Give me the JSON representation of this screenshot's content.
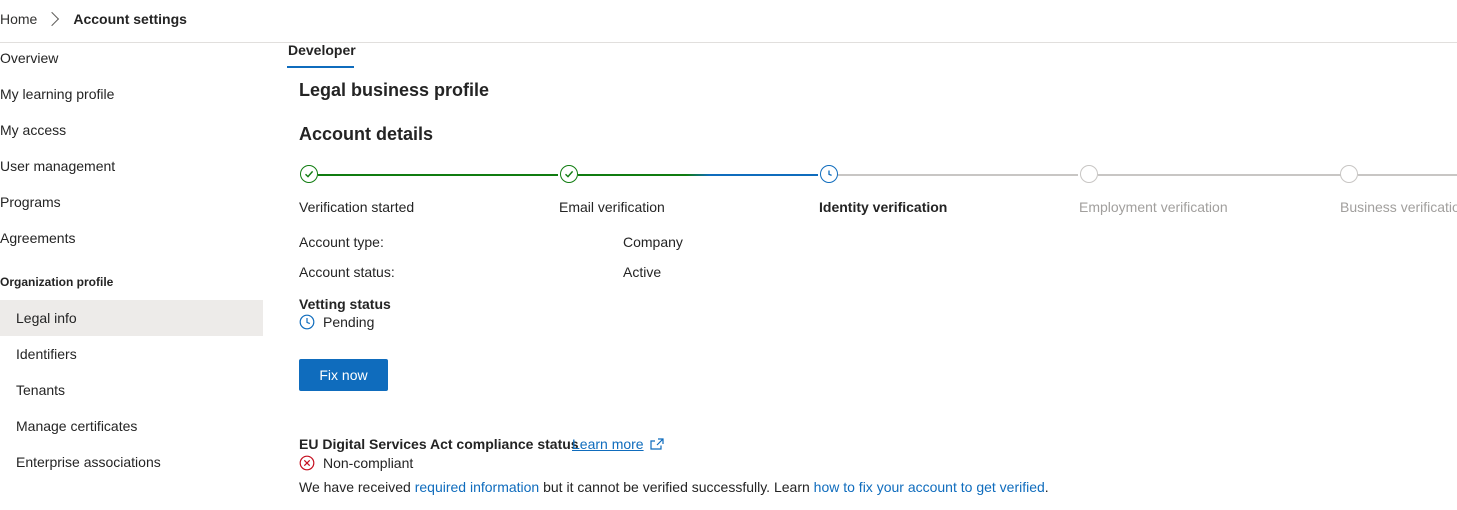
{
  "breadcrumb": {
    "home": "Home",
    "current": "Account settings"
  },
  "sidebar": {
    "items": [
      {
        "label": "Overview"
      },
      {
        "label": "My learning profile"
      },
      {
        "label": "My access"
      },
      {
        "label": "User management"
      },
      {
        "label": "Programs"
      },
      {
        "label": "Agreements"
      }
    ],
    "section_heading": "Organization profile",
    "subitems": [
      {
        "label": "Legal info",
        "selected": true
      },
      {
        "label": "Identifiers"
      },
      {
        "label": "Tenants"
      },
      {
        "label": "Manage certificates"
      },
      {
        "label": "Enterprise associations"
      }
    ]
  },
  "tabs": [
    {
      "label": "Developer",
      "active": true
    }
  ],
  "main": {
    "legal_heading": "Legal business profile",
    "details_heading": "Account details",
    "steps": [
      {
        "label": "Verification started",
        "state": "complete",
        "icon": "check-circle-icon"
      },
      {
        "label": "Email verification",
        "state": "complete",
        "icon": "check-circle-icon"
      },
      {
        "label": "Identity verification",
        "state": "current",
        "icon": "clock-icon"
      },
      {
        "label": "Employment verification",
        "state": "pending",
        "icon": "empty-circle-icon"
      },
      {
        "label": "Business verificatio",
        "state": "pending",
        "icon": "empty-circle-icon"
      }
    ],
    "account_type_label": "Account type:",
    "account_type_value": "Company",
    "account_status_label": "Account status:",
    "account_status_value": "Active",
    "vetting_title": "Vetting status",
    "vetting_value": "Pending",
    "fix_button": "Fix now",
    "eu_title": "EU Digital Services Act compliance status",
    "eu_learn_more": "Learn more",
    "eu_status": "Non-compliant",
    "eu_msg_1": "We have received ",
    "eu_msg_link1": "required information",
    "eu_msg_2": " but it cannot be verified successfully. Learn ",
    "eu_msg_link2": "how to fix your account to get verified",
    "eu_msg_3": "."
  },
  "colors": {
    "accent": "#0f6cbd",
    "success": "#107c10",
    "error": "#c50f1f",
    "muted": "#a19f9d"
  }
}
